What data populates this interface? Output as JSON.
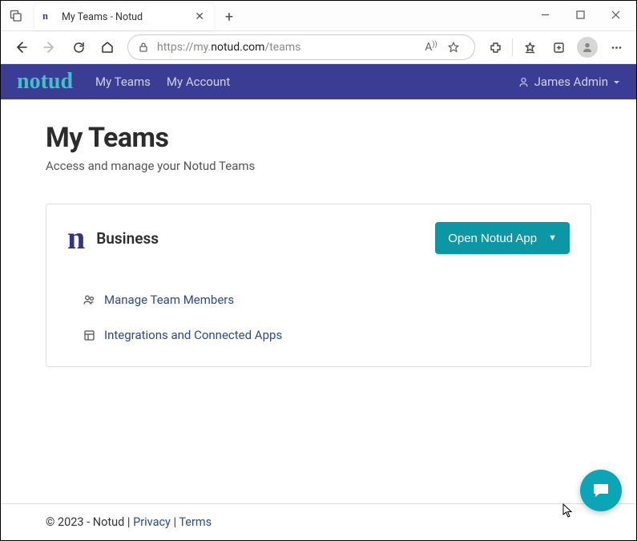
{
  "browser": {
    "tab_title": "My Teams - Notud",
    "url_prefix": "https://",
    "url_hostpre": "my.",
    "url_host": "notud.com",
    "url_path": "/teams"
  },
  "navbar": {
    "brand": "notud",
    "my_teams": "My Teams",
    "my_account": "My Account",
    "user_name": "James Admin"
  },
  "page": {
    "title": "My Teams",
    "subtitle": "Access and manage your Notud Teams"
  },
  "team_card": {
    "icon_glyph": "n",
    "name": "Business",
    "open_app_label": "Open Notud App",
    "manage_members": "Manage Team Members",
    "integrations": "Integrations and Connected Apps"
  },
  "footer": {
    "copyright": "© 2023 - Notud | ",
    "privacy": "Privacy",
    "separator": " | ",
    "terms": "Terms"
  }
}
